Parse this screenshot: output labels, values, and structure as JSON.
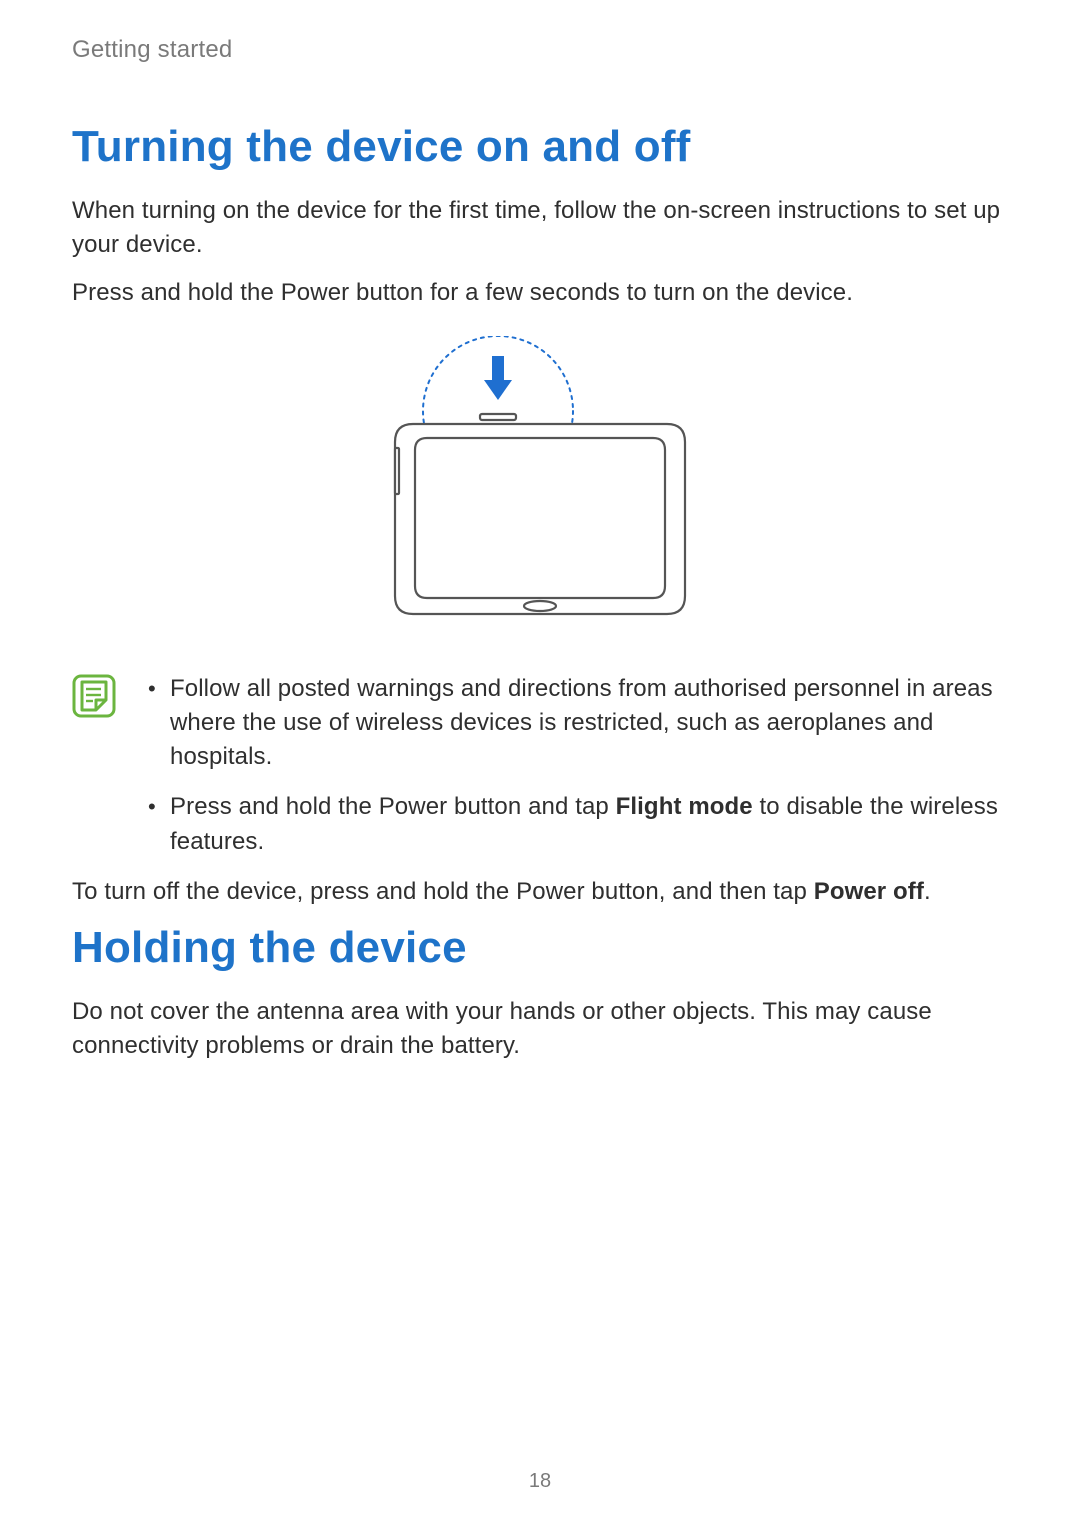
{
  "runningHead": "Getting started",
  "section1": {
    "title": "Turning the device on and off",
    "para1": "When turning on the device for the first time, follow the on-screen instructions to set up your device.",
    "para2": "Press and hold the Power button for a few seconds to turn on the device.",
    "notes": {
      "item1": "Follow all posted warnings and directions from authorised personnel in areas where the use of wireless devices is restricted, such as aeroplanes and hospitals.",
      "item2_pre": "Press and hold the Power button and tap ",
      "item2_bold": "Flight mode",
      "item2_post": " to disable the wireless features."
    },
    "afterNote_pre": "To turn off the device, press and hold the Power button, and then tap ",
    "afterNote_bold": "Power off",
    "afterNote_post": "."
  },
  "section2": {
    "title": "Holding the device",
    "para1": "Do not cover the antenna area with your hands or other objects. This may cause connectivity problems or drain the battery."
  },
  "pageNumber": "18",
  "icons": {
    "noteIcon": "note-icon",
    "powerArrow": "down-arrow-icon",
    "deviceIllustration": "tablet-power-illustration"
  }
}
